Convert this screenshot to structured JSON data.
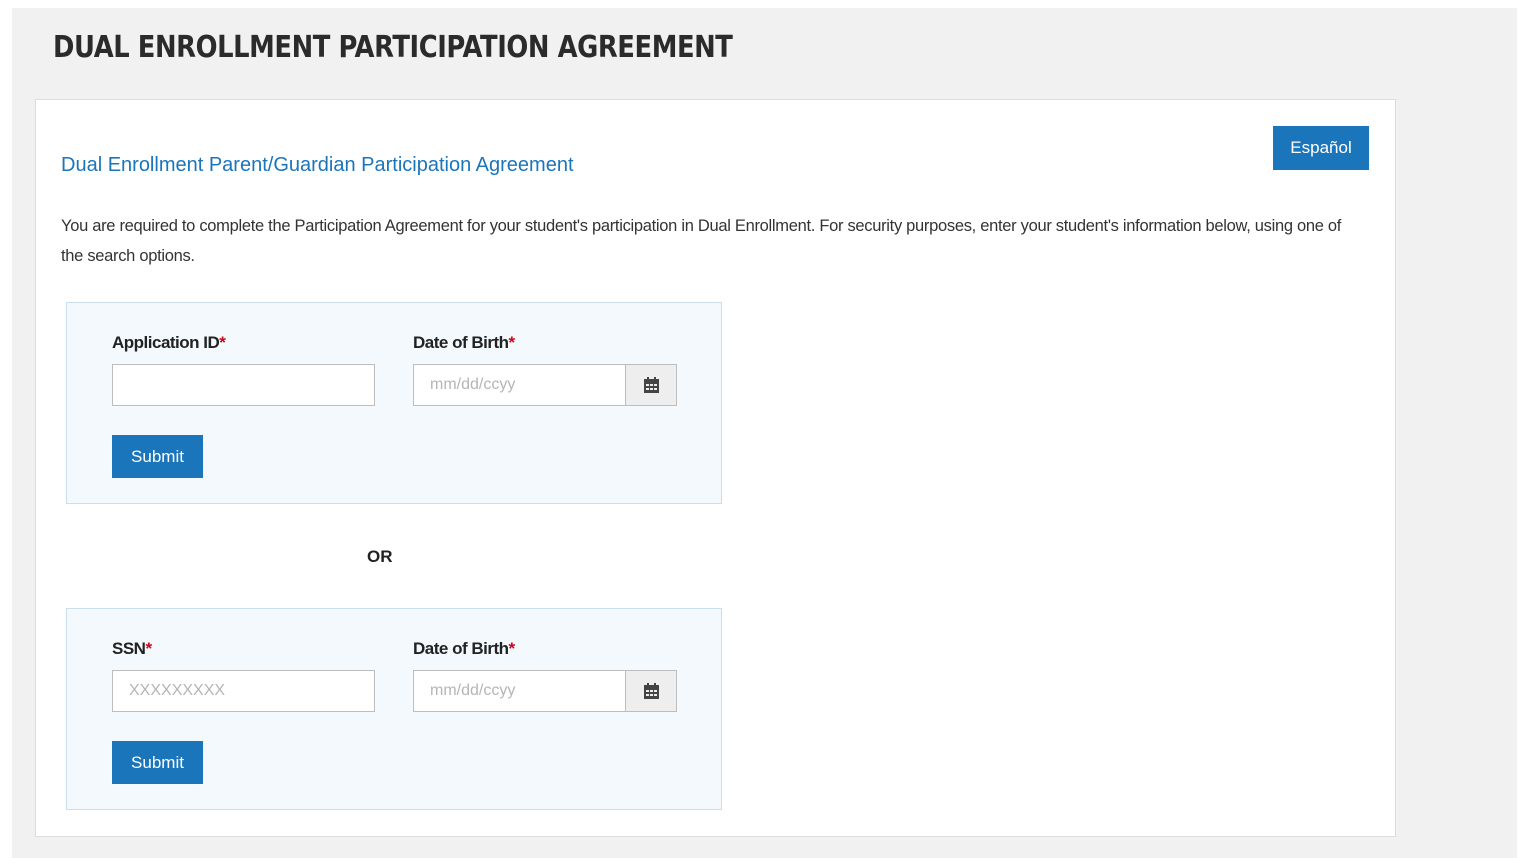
{
  "page": {
    "title": "DUAL ENROLLMENT PARTICIPATION AGREEMENT"
  },
  "card": {
    "heading": "Dual Enrollment Parent/Guardian Participation Agreement",
    "language_button": "Español",
    "intro": "You are required to complete the Participation Agreement for your student's participation in Dual Enrollment. For security purposes, enter your student's information below, using one of the search options."
  },
  "search_by_application": {
    "application_id_label": "Application ID",
    "application_id_value": "",
    "application_id_placeholder": "",
    "dob_label": "Date of Birth",
    "dob_placeholder": "mm/dd/ccyy",
    "submit_label": "Submit"
  },
  "separator": {
    "or_label": "OR"
  },
  "search_by_ssn": {
    "ssn_label": "SSN",
    "ssn_placeholder": "XXXXXXXXX",
    "dob_label": "Date of Birth",
    "dob_placeholder": "mm/dd/ccyy",
    "submit_label": "Submit"
  },
  "required_marker": "*",
  "icons": {
    "calendar": "calendar-icon"
  },
  "colors": {
    "accent": "#1b75bb",
    "required": "#d0021b",
    "panel_background": "#f3f9fd",
    "page_background": "#f1f1f1"
  }
}
